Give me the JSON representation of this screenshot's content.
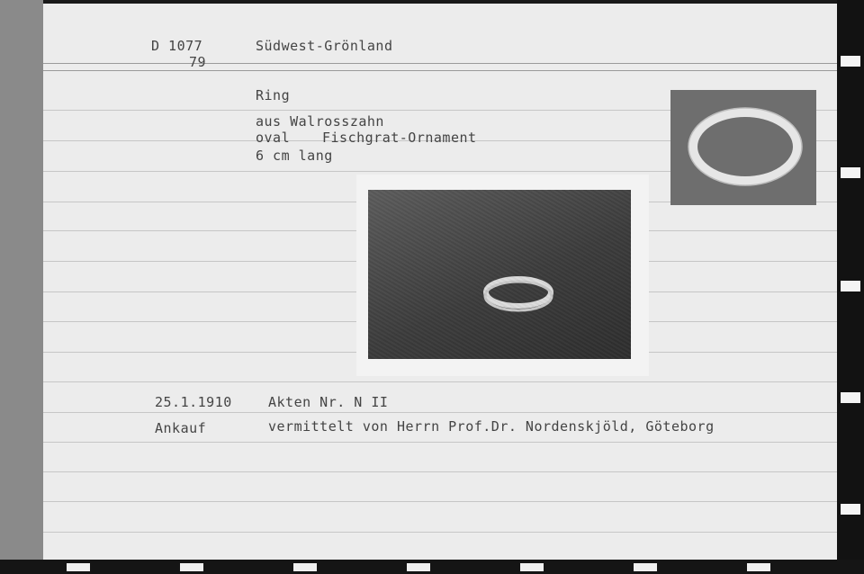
{
  "card": {
    "catalog_number": "D 1077",
    "catalog_subnumber": "79",
    "region": "Südwest-Grönland",
    "object": "Ring",
    "material": "aus Walrosszahn",
    "shape": "oval",
    "ornament": "Fischgrat-Ornament",
    "size": "6 cm lang",
    "date": "25.1.1910",
    "files": "Akten Nr. N II",
    "acquisition": "Ankauf",
    "acquisition_note": "vermittelt von Herrn Prof.Dr. Nordenskjöld, Göteborg"
  },
  "photos": {
    "small_icon": "ring-photo-top-view",
    "large_icon": "ring-photo-perspective"
  },
  "colors": {
    "card": "#ececec",
    "ink": "#444444",
    "rule": "#c6c6c6",
    "film": "#121212"
  }
}
